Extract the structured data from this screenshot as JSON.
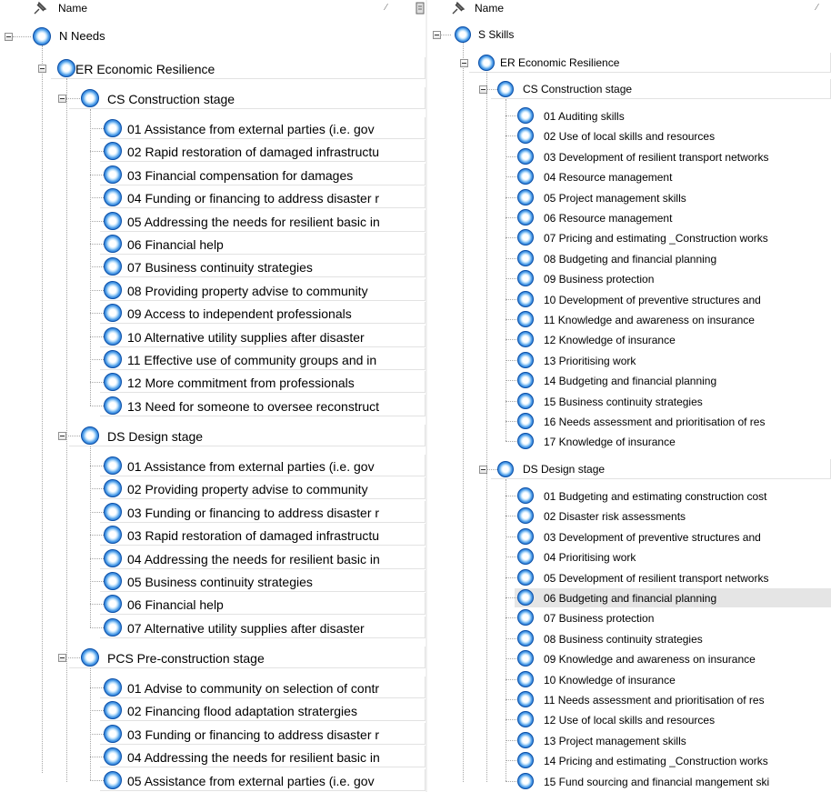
{
  "left_panel": {
    "header_label": "Name",
    "root": {
      "label": "N Needs",
      "children": [
        {
          "label": "ER Economic Resilience",
          "children": [
            {
              "label": "CS Construction stage",
              "items": [
                "01 Assistance from external parties (i.e. gov",
                "02 Rapid restoration of damaged infrastructu",
                "03 Financial compensation for damages",
                "04 Funding or financing to address disaster r",
                "05 Addressing the needs for resilient basic in",
                "06 Financial help",
                "07 Business continuity strategies",
                "08 Providing property advise to community",
                "09 Access to independent professionals",
                "10 Alternative utility supplies after disaster",
                "11 Effective use of community groups and in",
                "12 More commitment from professionals",
                "13 Need for someone to oversee reconstruct"
              ]
            },
            {
              "label": "DS Design stage",
              "items": [
                "01 Assistance from external parties (i.e. gov",
                "02 Providing property advise to community",
                "03 Funding or financing to address disaster r",
                "03 Rapid restoration of damaged infrastructu",
                "04 Addressing the needs for resilient basic in",
                "05 Business continuity strategies",
                "06 Financial help",
                "07 Alternative utility supplies after disaster"
              ]
            },
            {
              "label": "PCS Pre-construction stage",
              "items": [
                "01 Advise to community on selection of contr",
                "02 Financing flood adaptation stratergies",
                "03 Funding or financing to address disaster r",
                "04 Addressing the needs for resilient basic in",
                "05 Assistance from external parties (i.e. gov"
              ]
            }
          ]
        }
      ]
    }
  },
  "right_panel": {
    "header_label": "Name",
    "root": {
      "label": "S Skills",
      "children": [
        {
          "label": "ER Economic Resilience",
          "children": [
            {
              "label": "CS Construction stage",
              "items": [
                "01 Auditing skills",
                "02 Use of local skills and resources",
                "03 Development of resilient transport networks",
                "04 Resource management",
                "05 Project management skills",
                "06 Resource management",
                "07 Pricing and estimating _Construction works",
                "08 Budgeting and financial planning",
                "09 Business protection",
                "10 Development of preventive structures and",
                "11 Knowledge and awareness on insurance",
                "12 Knowledge of insurance",
                "13 Prioritising work",
                "14 Budgeting and financial planning",
                "15 Business continuity strategies",
                "16 Needs assessment and prioritisation of res",
                "17 Knowledge of insurance"
              ]
            },
            {
              "label": "DS Design stage",
              "items": [
                "01 Budgeting and estimating construction cost",
                "02 Disaster risk assessments",
                "03 Development of preventive structures and",
                "04 Prioritising work",
                "05 Development of resilient transport networks",
                "06 Budgeting and financial planning",
                "07 Business protection",
                "08 Business continuity strategies",
                "09 Knowledge and awareness on insurance",
                "10 Knowledge of insurance",
                "11 Needs assessment and prioritisation of res",
                "12 Use of local skills and resources",
                "13 Project management skills",
                "14 Pricing and estimating _Construction works",
                "15 Fund sourcing and financial mangement ski"
              ]
            }
          ]
        }
      ]
    }
  },
  "selected_item": "06 Budgeting and financial planning",
  "icons": {
    "node": "blue-circle-node-icon",
    "pin": "pin-icon",
    "toggle": "collapse-minus-icon"
  },
  "colors": {
    "node_blue": "#1f6fd0",
    "selection": "#e5e5e5",
    "tree_lines": "#a6a6a6"
  }
}
